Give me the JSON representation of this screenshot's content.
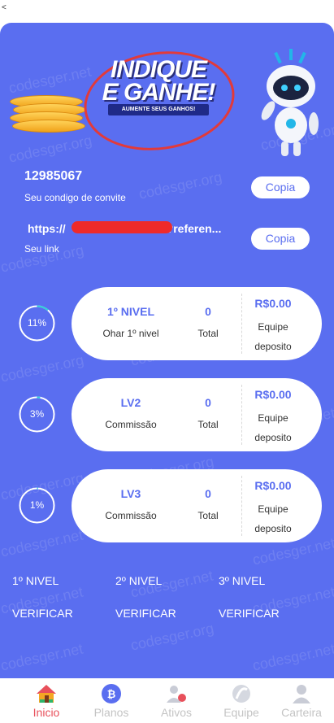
{
  "top": {
    "back_glyph": "<"
  },
  "banner": {
    "title_line1": "INDIQUE",
    "title_line2": "E GANHE!",
    "subtitle": "AUMENTE SEUS GANHOS!"
  },
  "invite": {
    "code": "12985067",
    "code_caption": "Seu condigo de convite",
    "link": "https://",
    "link_suffix": "?referen...",
    "link_caption": "Seu link",
    "copy_label": "Copia"
  },
  "levels": [
    {
      "ring_percent_label": "11%",
      "ring_fraction": 0.11,
      "title": "1º NIVEL",
      "subtitle": "Ohar 1º nivel",
      "count": "0",
      "count_label": "Total",
      "amount": "R$0.00",
      "amount_label_line1": "Equipe",
      "amount_label_line2": "deposito"
    },
    {
      "ring_percent_label": "3%",
      "ring_fraction": 0.03,
      "title": "LV2",
      "subtitle": "Commissão",
      "count": "0",
      "count_label": "Total",
      "amount": "R$0.00",
      "amount_label_line1": "Equipe",
      "amount_label_line2": "deposito"
    },
    {
      "ring_percent_label": "1%",
      "ring_fraction": 0.01,
      "title": "LV3",
      "subtitle": "Commissão",
      "count": "0",
      "count_label": "Total",
      "amount": "R$0.00",
      "amount_label_line1": "Equipe",
      "amount_label_line2": "deposito"
    }
  ],
  "level_links": [
    {
      "label": "1º NIVEL",
      "action": "VERIFICAR"
    },
    {
      "label": "2º NIVEL",
      "action": "VERIFICAR"
    },
    {
      "label": "3º NIVEL",
      "action": "VERIFICAR"
    }
  ],
  "watermark": "codesger.net",
  "watermark_alt": "codesger.org",
  "tabs": [
    {
      "label": "Inicio",
      "icon": "home-icon",
      "active": true
    },
    {
      "label": "Planos",
      "icon": "plans-coin-icon",
      "active": false
    },
    {
      "label": "Ativos",
      "icon": "assets-people-icon",
      "active": false
    },
    {
      "label": "Equipe",
      "icon": "team-icon",
      "active": false
    },
    {
      "label": "Carteira",
      "icon": "wallet-person-icon",
      "active": false
    }
  ],
  "colors": {
    "background": "#5a6ef0",
    "accent_active": "#e8505b",
    "ring_progress": "#2fd3d6",
    "tab_inactive": "#c4c4c4"
  }
}
